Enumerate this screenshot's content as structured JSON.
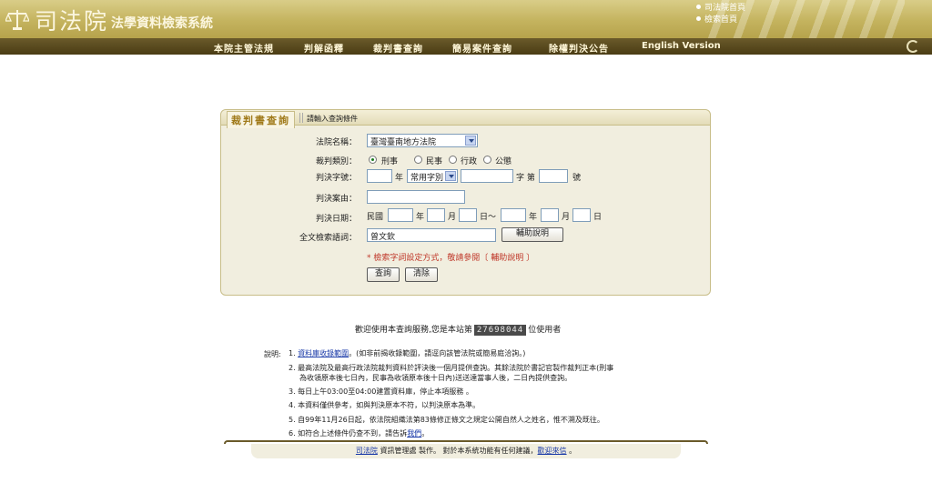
{
  "header": {
    "logo_main": "司法院",
    "logo_sub": "法學資料檢索系統",
    "top_links": [
      "司法院首頁",
      "檢索首頁"
    ]
  },
  "nav": {
    "items": [
      "本院主管法規",
      "判解函釋",
      "裁判書查詢",
      "簡易案件查詢",
      "除權判決公告",
      "English Version"
    ]
  },
  "panel": {
    "tab_label": "裁判書查詢",
    "title": "請輸入查詢條件",
    "court_label": "法院名稱：",
    "court_value": "臺灣臺南地方法院",
    "category_label": "裁判類別：",
    "categories": [
      "刑事",
      "民事",
      "行政",
      "公懲"
    ],
    "category_selected": 0,
    "number_label": "判決字號：",
    "number_year_unit": "年",
    "number_word_select": "常用字別",
    "number_word_unit": "字 第",
    "number_no_unit": "號",
    "reason_label": "判決案由：",
    "date_label": "判決日期：",
    "date_era": "民國",
    "date_year_unit": "年",
    "date_month_unit": "月",
    "date_day_unit": "日",
    "date_range_sep": "日～",
    "fulltext_label": "全文檢索語詞：",
    "fulltext_value": "曾文欽",
    "help_button": "輔助說明",
    "hint": "* 檢索字詞設定方式，敬請參閱〔 輔助說明 〕",
    "search_button": "查詢",
    "clear_button": "清除"
  },
  "counter": {
    "before": "歡迎使用本查詢服務,您是本站第",
    "value": "27698044",
    "after": "位使用者"
  },
  "notes": {
    "label": "說明:",
    "n1_prefix": "1.",
    "n1_link": "資料庫收錄範圍",
    "n1_rest": "。(如非前揭收錄範圍，請逕向該管法院或簡易庭洽詢。)",
    "n2_line1": "2. 最高法院及最高行政法院裁判資料於評決後一個月提供查詢。其餘法院於書記官製作裁判正本(刑事",
    "n2_line2": "為收領原本後七日內，民事為收領原本後十日內)送送達當事人後，二日內提供查詢。",
    "n3": "3. 每日上午03:00至04:00建置資料庫，停止本項服務 。",
    "n4": "4. 本資料僅供參考，如與判決原本不符，以判決原本為準。",
    "n5": "5. 自99年11月26日起，依法院組織法第83條修正條文之規定公開自然人之姓名，惟不溯及既往。",
    "n6_prefix": "6. 如符合上述條件仍查不到，請告訴",
    "n6_link": "我們",
    "n6_suffix": "。"
  },
  "footer": {
    "link1": "司法院",
    "middle": " 資訊管理處 製作。 對於本系統功能有任何建議，",
    "link2": "歡迎來信",
    "end": " 。"
  },
  "colors": {
    "header_gold": "#c4b35e",
    "nav_brown": "#4a3c14",
    "panel_bg": "#f1eedf",
    "hint_red": "#c0392b",
    "link_blue": "#1a3aa8"
  }
}
